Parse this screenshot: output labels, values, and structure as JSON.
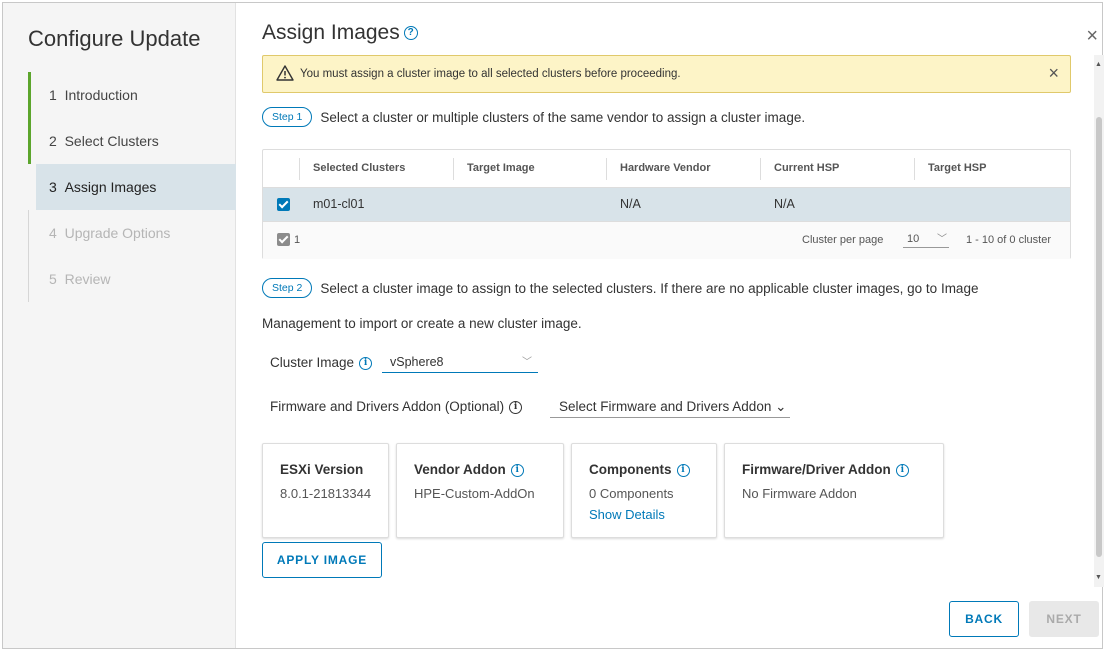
{
  "sidebar": {
    "title": "Configure Update",
    "steps": [
      {
        "num": "1",
        "label": "Introduction",
        "state": "done"
      },
      {
        "num": "2",
        "label": "Select Clusters",
        "state": "done"
      },
      {
        "num": "3",
        "label": "Assign Images",
        "state": "active"
      },
      {
        "num": "4",
        "label": "Upgrade Options",
        "state": "disabled"
      },
      {
        "num": "5",
        "label": "Review",
        "state": "disabled"
      }
    ]
  },
  "page": {
    "title": "Assign Images",
    "help_icon": "help-circle-icon",
    "close_icon": "×"
  },
  "alert": {
    "text": "You must assign a cluster image to all selected clusters before proceeding.",
    "icon": "warning-triangle-icon",
    "close": "×",
    "color": "#fdf4c7"
  },
  "step1": {
    "badge": "Step 1",
    "text": "Select a cluster or multiple clusters of the same vendor to assign a cluster image."
  },
  "grid": {
    "columns": [
      "Selected Clusters",
      "Target Image",
      "Hardware Vendor",
      "Current HSP",
      "Target HSP"
    ],
    "rows": [
      {
        "cluster": "m01-cl01",
        "target_image": "",
        "hardware_vendor": "N/A",
        "current_hsp": "N/A",
        "target_hsp": "",
        "selected": true
      }
    ],
    "footer": {
      "selected_count": "1",
      "per_page_label": "Cluster per page",
      "per_page_value": "10",
      "range": "1 - 10 of 0 cluster"
    }
  },
  "step2": {
    "badge": "Step 2",
    "text_line1": "Select a cluster image to assign to the selected clusters. If there are no applicable cluster images, go to Image",
    "text_line2": "Management to import or create a new cluster image."
  },
  "cluster_image": {
    "label": "Cluster Image",
    "value": "vSphere8"
  },
  "firmware": {
    "label": "Firmware and Drivers Addon (Optional)",
    "select": "Select Firmware and Drivers Addon ⌄"
  },
  "cards": [
    {
      "title": "ESXi Version",
      "value": "8.0.1-21813344",
      "info": false,
      "link": ""
    },
    {
      "title": "Vendor Addon",
      "value": "HPE-Custom-AddOn",
      "info": true,
      "link": ""
    },
    {
      "title": "Components",
      "value": "0 Components",
      "info": true,
      "link": "Show Details"
    },
    {
      "title": "Firmware/Driver Addon",
      "value": "No Firmware Addon",
      "info": true,
      "link": ""
    }
  ],
  "buttons": {
    "apply": "APPLY IMAGE",
    "back": "BACK",
    "next": "NEXT"
  },
  "colors": {
    "accent": "#0079b8",
    "progress_green": "#5ca52c",
    "selected_row": "#d8e3e9"
  }
}
